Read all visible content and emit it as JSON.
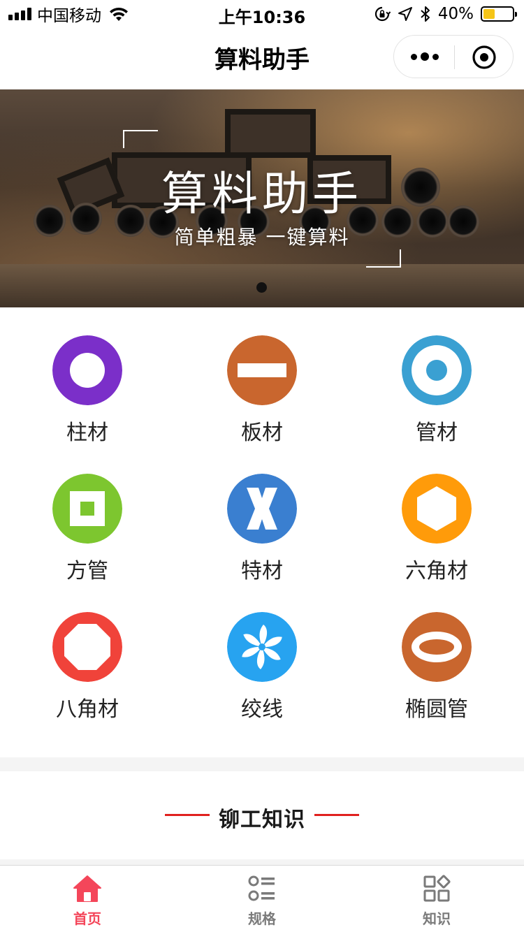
{
  "status_bar": {
    "carrier": "中国移动",
    "time": "上午10:36",
    "battery_percent": "40%",
    "battery_level": 0.4,
    "icons": [
      "signal-icon",
      "wifi-icon",
      "rotation-lock-icon",
      "location-icon",
      "bluetooth-icon",
      "battery-icon"
    ]
  },
  "nav": {
    "title": "算料助手",
    "more_icon": "more-dots-icon",
    "close_icon": "target-close-icon"
  },
  "banner": {
    "title": "算料助手",
    "subtitle": "简单粗暴 一键算料",
    "page_count": 1,
    "active_page": 1
  },
  "materials": [
    {
      "label": "柱材",
      "icon": "round-bar-icon",
      "color": "#7b2fc9"
    },
    {
      "label": "板材",
      "icon": "plate-icon",
      "color": "#c9662e"
    },
    {
      "label": "管材",
      "icon": "pipe-icon",
      "color": "#3aa0d2"
    },
    {
      "label": "方管",
      "icon": "square-tube-icon",
      "color": "#7dc62f"
    },
    {
      "label": "特材",
      "icon": "special-x-icon",
      "color": "#3a7fd0"
    },
    {
      "label": "六角材",
      "icon": "hexagon-bar-icon",
      "color": "#ff9b0a"
    },
    {
      "label": "八角材",
      "icon": "octagon-bar-icon",
      "color": "#f0433a"
    },
    {
      "label": "绞线",
      "icon": "stranded-wire-icon",
      "color": "#27a3f0"
    },
    {
      "label": "椭圆管",
      "icon": "oval-tube-icon",
      "color": "#c9662e"
    }
  ],
  "knowledge": {
    "title": "铆工知识",
    "accent_color": "#e0211f"
  },
  "tabs": [
    {
      "label": "首页",
      "icon": "home-icon",
      "active": true
    },
    {
      "label": "规格",
      "icon": "list-icon",
      "active": false
    },
    {
      "label": "知识",
      "icon": "grid-apps-icon",
      "active": false
    }
  ],
  "colors": {
    "tab_active": "#f4465a",
    "tab_inactive": "#7a7a7a"
  }
}
